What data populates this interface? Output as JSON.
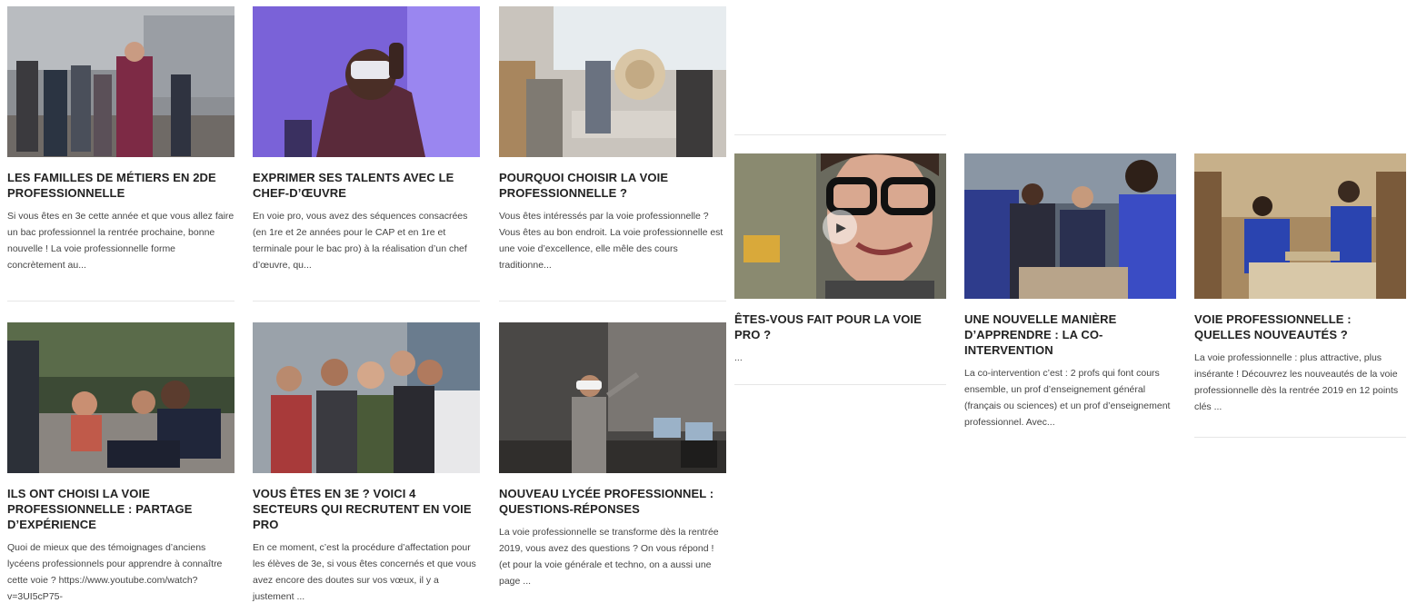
{
  "articles": [
    {
      "title": "LES FAMILLES DE MÉTIERS EN 2DE PROFESSIONNELLE",
      "excerpt": "Si vous êtes en 3e cette année et que vous allez faire un bac professionnel la rentrée prochaine, bonne nouvelle ! La voie professionnelle forme concrètement au...",
      "image": "students-walking-photo"
    },
    {
      "title": "EXPRIMER SES TALENTS AVEC LE CHEF-D’ŒUVRE",
      "excerpt": "En voie pro, vous avez des séquences consacrées (en 1re et 2e années pour le CAP et en 1re et terminale pour le bac pro) à la réalisation d’un chef d’œuvre, qu...",
      "image": "vr-headset-purple-photo"
    },
    {
      "title": "POURQUOI CHOISIR LA VOIE PROFESSIONNELLE ?",
      "excerpt": "Vous êtes intéressés par la voie professionnelle ? Vous êtes au bon endroit. La voie professionnelle est une voie d’excellence, elle mêle des cours traditionne...",
      "image": "workshop-table-photo"
    },
    {
      "title": "ILS ONT CHOISI LA VOIE PROFESSIONNELLE : PARTAGE D’EXPÉRIENCE",
      "excerpt": "Quoi de mieux que des témoignages d’anciens lycéens professionnels pour apprendre à connaître cette voie ? https://www.youtube.com/watch?v=3UI5cP75-",
      "image": "students-outdoor-photo"
    },
    {
      "title": "VOUS ÊTES EN 3E ? VOICI 4 SECTEURS QUI RECRUTENT EN VOIE PRO",
      "excerpt": "En ce moment, c’est la procédure d’affectation pour les élèves de 3e, si vous êtes concernés et que vous avez encore des doutes sur vos vœux, il y a justement ...",
      "image": "group-selfie-photo"
    },
    {
      "title": "NOUVEAU LYCÉE PROFESSIONNEL : QUESTIONS-RÉPONSES",
      "excerpt": "La voie professionnelle se transforme dès la rentrée 2019, vous avez des questions ? On vous répond ! (et pour la voie générale et techno, on a aussi une page ...",
      "image": "vr-classroom-photo"
    },
    {
      "title": "ÊTES-VOUS FAIT POUR LA VOIE PRO ?",
      "excerpt": "...",
      "image": "young-man-glasses-video"
    },
    {
      "title": "UNE NOUVELLE MANIÈRE D’APPRENDRE : LA CO-INTERVENTION",
      "excerpt": "La co-intervention c’est : 2 profs qui font cours ensemble, un prof d’enseignement général (français ou sciences) et un prof d’enseignement professionnel. Avec...",
      "image": "lab-students-photo"
    },
    {
      "title": "VOIE PROFESSIONNELLE : QUELLES NOUVEAUTÉS ?",
      "excerpt": "La voie professionnelle : plus attractive, plus insérante ! Découvrez les nouveautés de la voie professionnelle dès la rentrée 2019 en 12 points clés ...",
      "image": "woodwork-photo"
    }
  ],
  "icons": {
    "play": "play-icon",
    "play_glyph": "▶"
  },
  "colors": {
    "title": "#222222",
    "excerpt": "#444444",
    "divider": "#e6e6e6"
  }
}
